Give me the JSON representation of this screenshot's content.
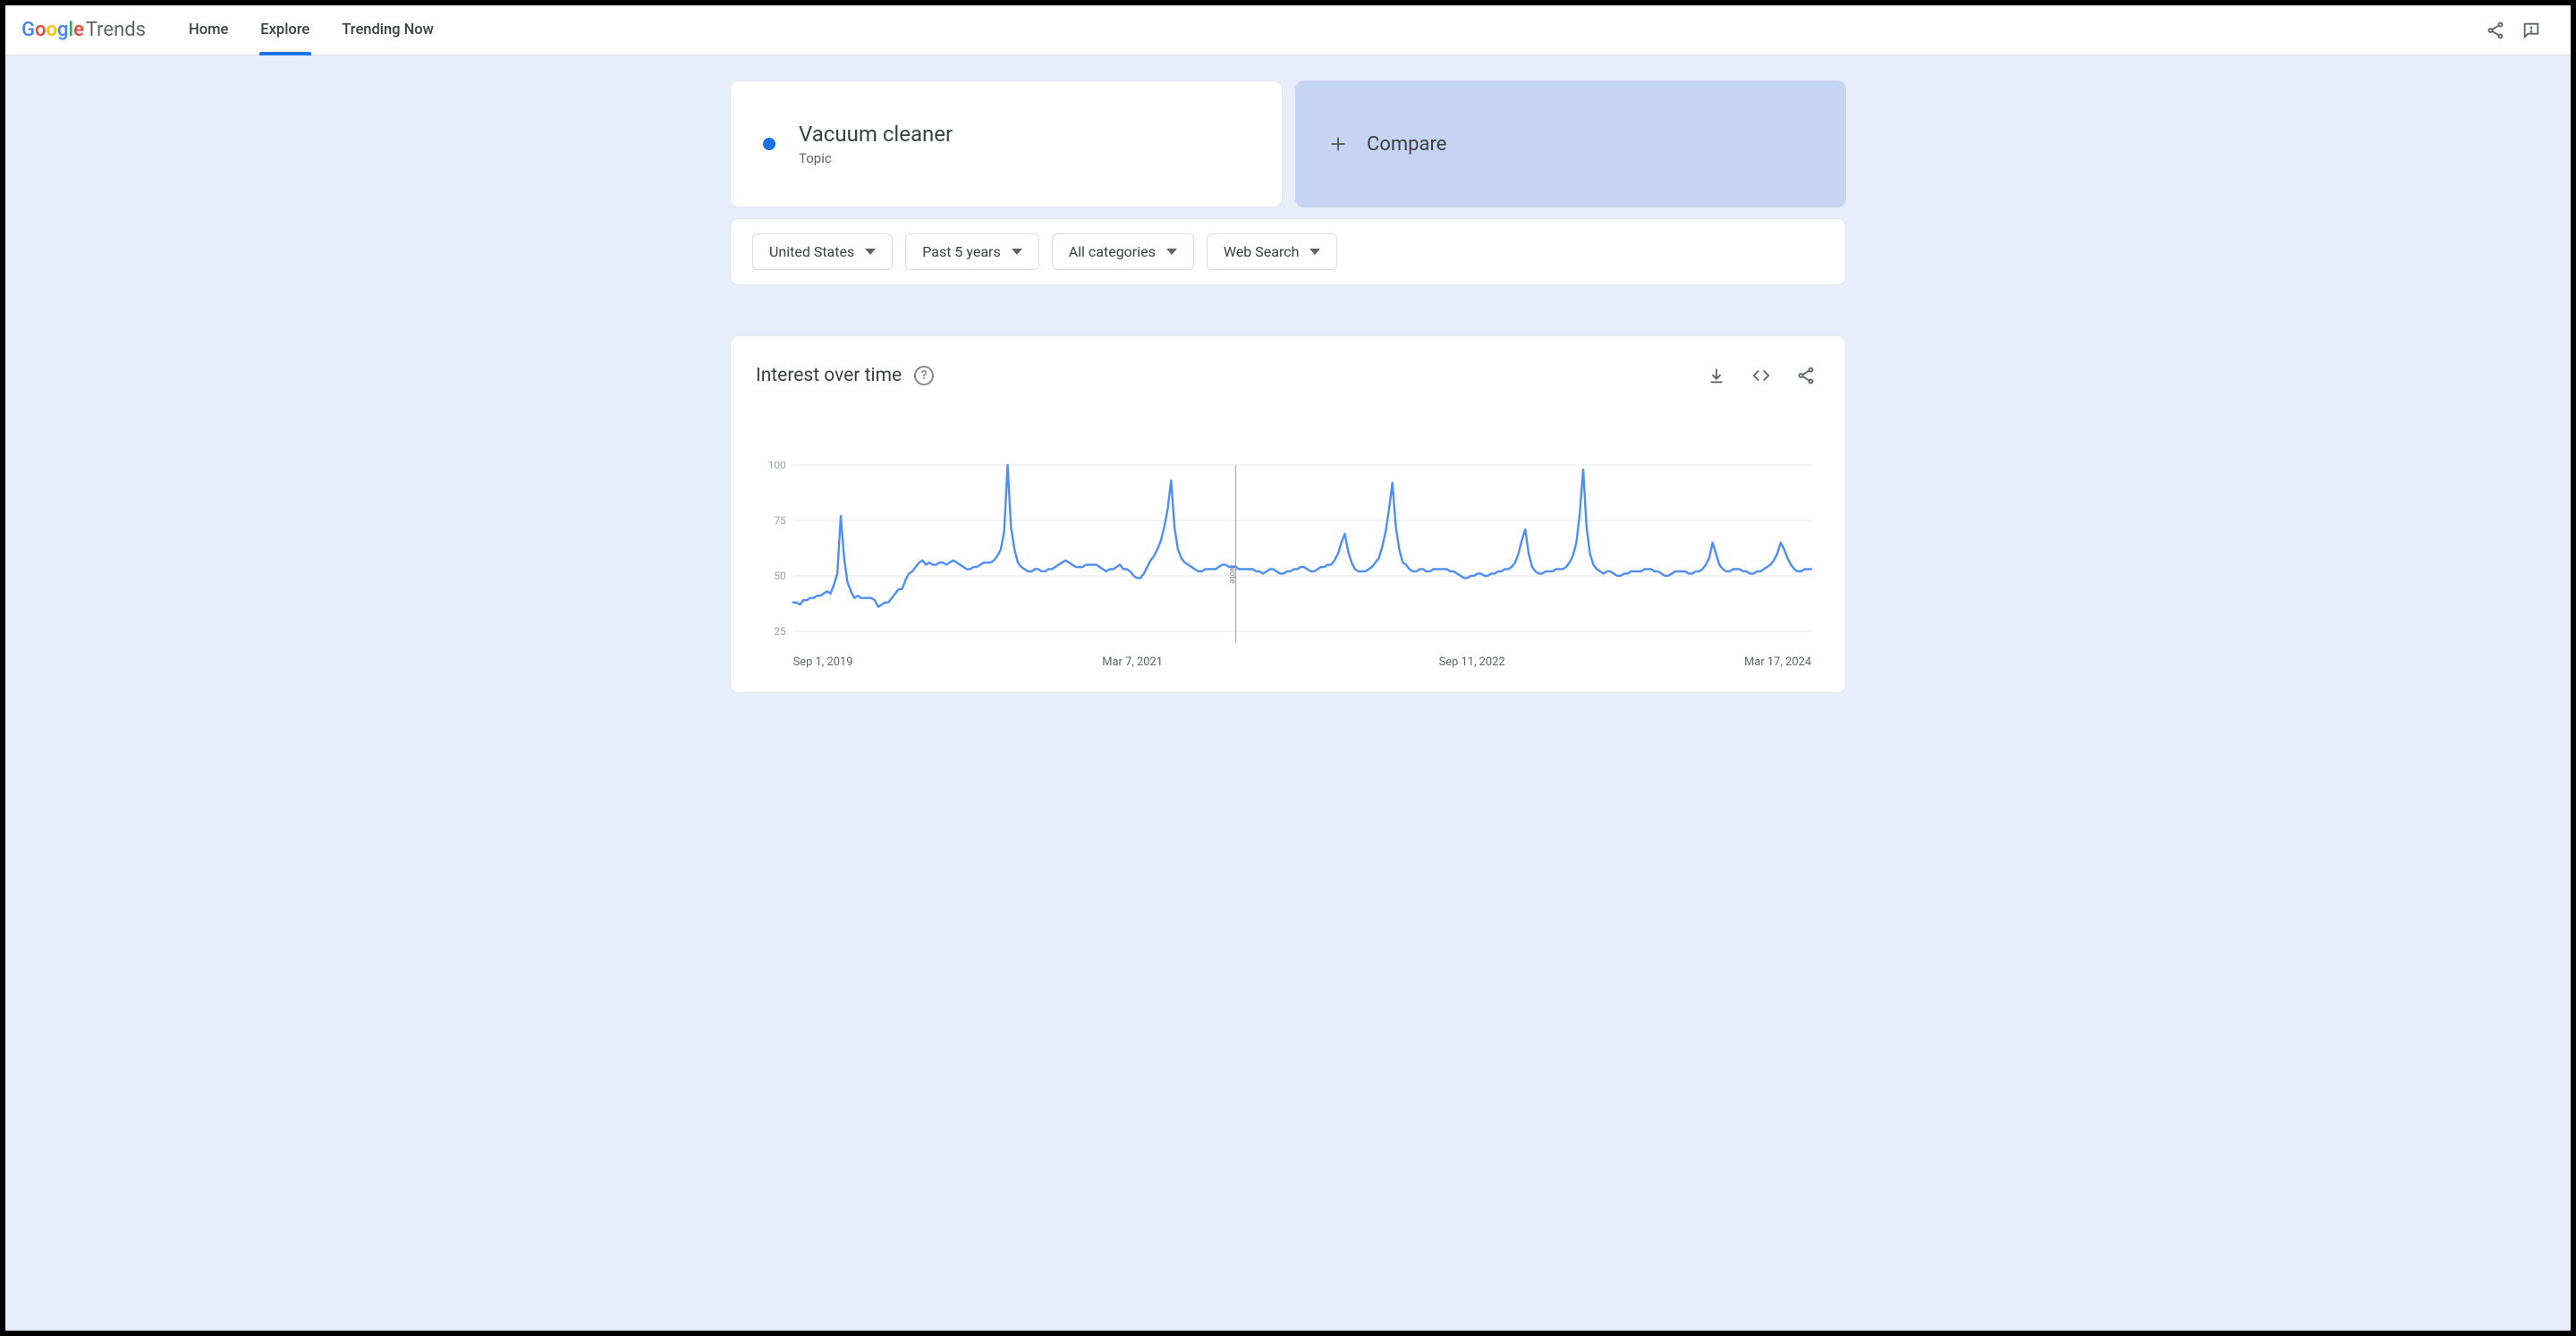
{
  "logo": {
    "brand": "Google",
    "product": "Trends"
  },
  "nav": {
    "home": "Home",
    "explore": "Explore",
    "trending": "Trending Now",
    "active": "explore"
  },
  "query": {
    "term": "Vacuum cleaner",
    "subtitle": "Topic"
  },
  "compare": {
    "label": "Compare"
  },
  "filters": {
    "geo": "United States",
    "time": "Past 5 years",
    "category": "All categories",
    "search_type": "Web Search"
  },
  "chart": {
    "title": "Interest over time",
    "note": "Note",
    "x_ticks": [
      "Sep 1, 2019",
      "Mar 7, 2021",
      "Sep 11, 2022",
      "Mar 17, 2024"
    ],
    "y_ticks": [
      "100",
      "75",
      "50",
      "25"
    ]
  },
  "chart_data": {
    "type": "line",
    "title": "Interest over time",
    "xlabel": "",
    "ylabel": "",
    "ylim": [
      0,
      100
    ],
    "y_ticks": [
      25,
      50,
      75,
      100
    ],
    "x_tick_labels": [
      "Sep 1, 2019",
      "Mar 7, 2021",
      "Sep 11, 2022",
      "Mar 17, 2024"
    ],
    "note_index": 130,
    "series": [
      {
        "name": "Vacuum cleaner",
        "color": "#4c8df6",
        "values": [
          38,
          38,
          37,
          39,
          39,
          40,
          40,
          41,
          41,
          42,
          43,
          42,
          46,
          51,
          77,
          58,
          47,
          43,
          40,
          41,
          40,
          40,
          40,
          40,
          39,
          36,
          37,
          38,
          38,
          40,
          42,
          44,
          44,
          48,
          51,
          52,
          54,
          56,
          57,
          55,
          56,
          55,
          55,
          56,
          56,
          55,
          56,
          57,
          56,
          55,
          54,
          53,
          53,
          54,
          54,
          55,
          56,
          56,
          56,
          57,
          59,
          62,
          70,
          100,
          72,
          62,
          56,
          54,
          53,
          52,
          52,
          53,
          53,
          52,
          52,
          53,
          53,
          54,
          55,
          56,
          57,
          56,
          55,
          54,
          54,
          54,
          55,
          55,
          55,
          55,
          54,
          53,
          52,
          53,
          53,
          54,
          55,
          53,
          53,
          52,
          50,
          49,
          49,
          51,
          54,
          57,
          59,
          62,
          66,
          72,
          80,
          93,
          72,
          62,
          58,
          56,
          55,
          54,
          53,
          52,
          52,
          53,
          53,
          53,
          53,
          54,
          55,
          55,
          54,
          54,
          54,
          53,
          53,
          53,
          53,
          53,
          52,
          52,
          51,
          52,
          53,
          53,
          52,
          51,
          51,
          52,
          52,
          53,
          53,
          54,
          54,
          53,
          52,
          52,
          53,
          54,
          54,
          55,
          55,
          57,
          60,
          65,
          69,
          61,
          56,
          53,
          52,
          52,
          52,
          53,
          54,
          56,
          58,
          63,
          70,
          80,
          92,
          72,
          62,
          56,
          55,
          53,
          52,
          52,
          53,
          53,
          52,
          52,
          53,
          53,
          53,
          53,
          53,
          52,
          52,
          51,
          50,
          49,
          49,
          50,
          50,
          51,
          51,
          50,
          50,
          51,
          51,
          52,
          52,
          53,
          53,
          54,
          56,
          60,
          66,
          71,
          60,
          54,
          52,
          51,
          51,
          52,
          52,
          52,
          53,
          53,
          53,
          54,
          56,
          59,
          65,
          78,
          98,
          72,
          60,
          55,
          53,
          52,
          51,
          52,
          52,
          51,
          50,
          50,
          51,
          51,
          52,
          52,
          52,
          52,
          53,
          53,
          53,
          52,
          52,
          51,
          50,
          50,
          51,
          52,
          52,
          52,
          52,
          51,
          51,
          52,
          52,
          53,
          55,
          58,
          65,
          60,
          55,
          53,
          52,
          52,
          53,
          53,
          53,
          52,
          52,
          51,
          51,
          52,
          52,
          53,
          54,
          55,
          57,
          60,
          65,
          62,
          58,
          55,
          53,
          52,
          52,
          53,
          53,
          53
        ]
      }
    ]
  }
}
